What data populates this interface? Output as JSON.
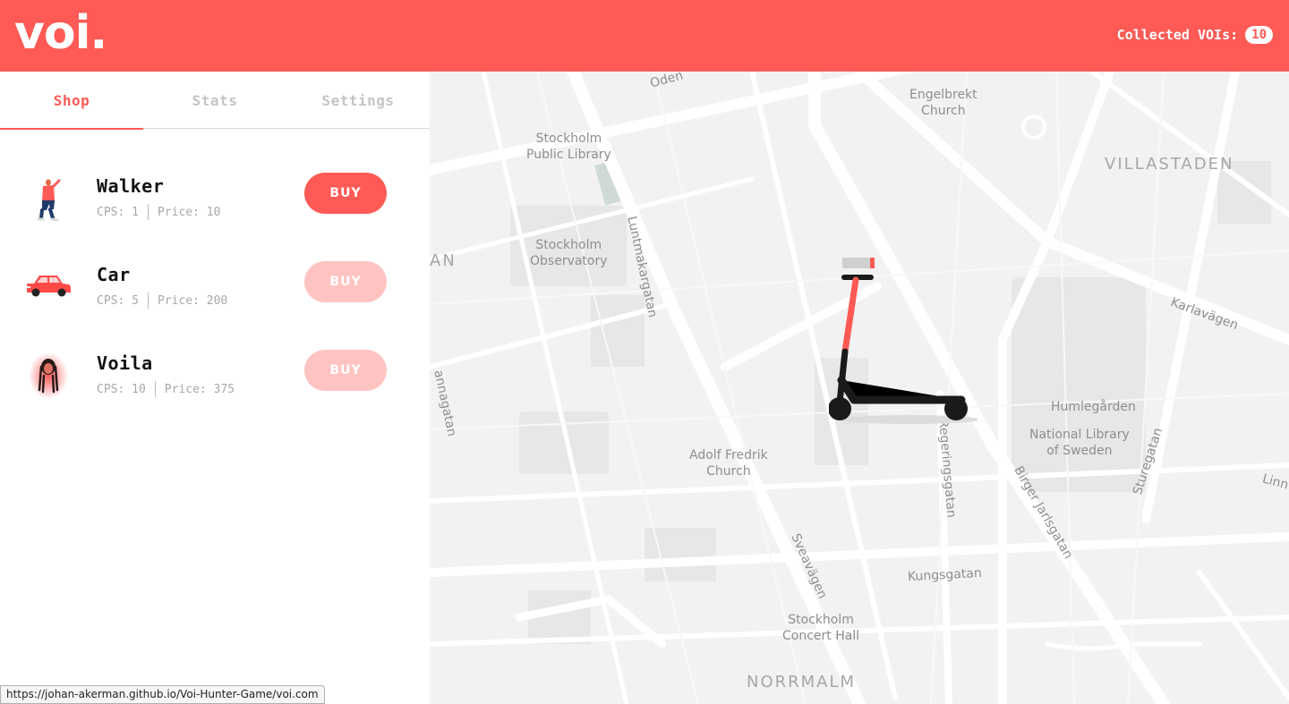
{
  "header": {
    "logo": "voi.",
    "collected_label": "Collected VOIs:",
    "collected_count": "10",
    "color": "#ff5a55"
  },
  "tabs": [
    {
      "label": "Shop",
      "active": true
    },
    {
      "label": "Stats",
      "active": false
    },
    {
      "label": "Settings",
      "active": false
    }
  ],
  "shop": {
    "items": [
      {
        "name": "Walker",
        "cps": "CPS: 1",
        "price": "Price: 10",
        "button": "BUY",
        "enabled": true,
        "icon": "walker-icon"
      },
      {
        "name": "Car",
        "cps": "CPS: 5",
        "price": "Price: 200",
        "button": "BUY",
        "enabled": false,
        "icon": "car-icon"
      },
      {
        "name": "Voila",
        "cps": "CPS: 10",
        "price": "Price: 375",
        "button": "BUY",
        "enabled": false,
        "icon": "voila-icon"
      }
    ]
  },
  "map": {
    "labels": {
      "odengatan": "Oden",
      "engelbrekt": "Engelbrekt\nChurch",
      "library": "Stockholm\nPublic Library",
      "villastaden": "VILLASTADEN",
      "luntmakargatan": "Luntmakargatan",
      "observatory": "Stockholm\nObservatory",
      "an": "AN",
      "karlavagen": "Karlavägen",
      "humlegarden": "Humlegården",
      "national_library": "National Library\nof Sweden",
      "annagatan": "annagatan",
      "sturegatan": "Sturegatan",
      "linn": "Linn",
      "regeringsgatan": "Regeringsgatan",
      "adolf": "Adolf Fredrik\nChurch",
      "birger": "Birger Jarlsgatan",
      "sveavagen": "Sveavägen",
      "kungsgatan": "Kungsgatan",
      "concert_hall": "Stockholm\nConcert Hall",
      "normalm": "NORRMALM"
    },
    "scooter_icon": "scooter-icon"
  },
  "statusbar": {
    "url": "https://johan-akerman.github.io/Voi-Hunter-Game/voi.com"
  }
}
